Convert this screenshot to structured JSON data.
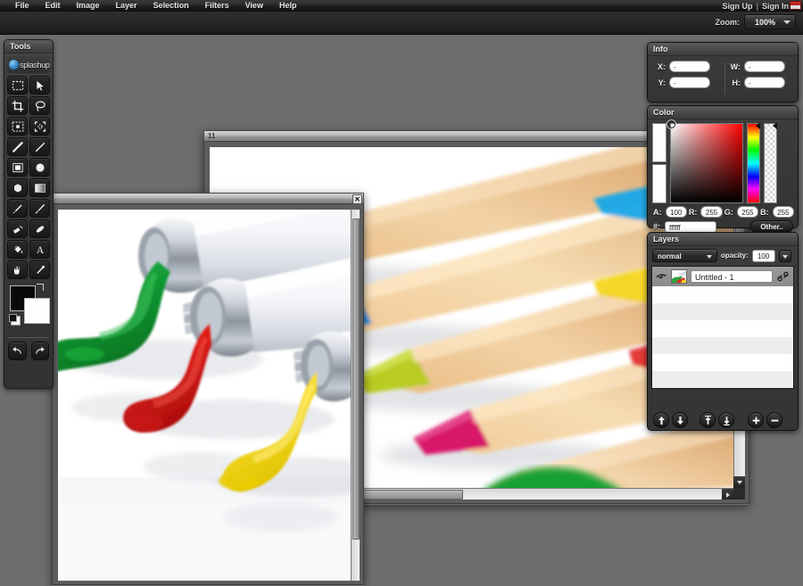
{
  "menu": {
    "items": [
      {
        "label": "File"
      },
      {
        "label": "Edit"
      },
      {
        "label": "Image"
      },
      {
        "label": "Layer"
      },
      {
        "label": "Selection"
      },
      {
        "label": "Filters"
      },
      {
        "label": "View"
      },
      {
        "label": "Help"
      }
    ]
  },
  "auth": {
    "sign_up": "Sign Up",
    "separator": "|",
    "sign_in": "Sign In",
    "flag_icon": "flag-icon"
  },
  "toolbar": {
    "zoom_label": "Zoom:",
    "zoom_value": "100%"
  },
  "tools": {
    "title": "Tools",
    "logo_text": "splashup",
    "items": [
      {
        "name": "marquee-rectangle-tool",
        "icon": "marquee-rectangle-icon"
      },
      {
        "name": "move-tool",
        "icon": "cursor-arrow-icon"
      },
      {
        "name": "crop-tool",
        "icon": "crop-icon"
      },
      {
        "name": "lasso-tool",
        "icon": "lasso-icon"
      },
      {
        "name": "select-all-tool",
        "icon": "select-all-icon"
      },
      {
        "name": "magic-wand-select-tool",
        "icon": "dashed-square-icon"
      },
      {
        "name": "line-tool",
        "icon": "line-icon"
      },
      {
        "name": "pencil-tool",
        "icon": "pencil-stroke-icon"
      },
      {
        "name": "rectangle-shape-tool",
        "icon": "filled-square-icon"
      },
      {
        "name": "ellipse-shape-tool",
        "icon": "filled-circle-icon"
      },
      {
        "name": "polygon-shape-tool",
        "icon": "polygon-icon"
      },
      {
        "name": "gradient-tool",
        "icon": "gradient-icon"
      },
      {
        "name": "brush-tool",
        "icon": "brush-icon"
      },
      {
        "name": "paintbrush-tool",
        "icon": "paintbrush-icon"
      },
      {
        "name": "eraser-tool",
        "icon": "eraser-icon"
      },
      {
        "name": "smudge-tool",
        "icon": "smudge-icon"
      },
      {
        "name": "paint-bucket-tool",
        "icon": "paint-bucket-icon"
      },
      {
        "name": "text-tool",
        "icon": "text-a-icon"
      },
      {
        "name": "hand-tool",
        "icon": "hand-icon"
      },
      {
        "name": "eyedropper-tool",
        "icon": "eyedropper-icon"
      }
    ],
    "foreground_color": "#0a0a0a",
    "background_color": "#fdfdfd",
    "undo_icon": "undo-arrow-icon",
    "redo_icon": "redo-arrow-icon"
  },
  "info": {
    "title": "Info",
    "fields": [
      {
        "label": "X:",
        "value": "-"
      },
      {
        "label": "W:",
        "value": "-"
      },
      {
        "label": "Y:",
        "value": "-"
      },
      {
        "label": "H:",
        "value": "-"
      }
    ]
  },
  "color": {
    "title": "Color",
    "alpha_label": "A:",
    "alpha_value": "100",
    "red_label": "R:",
    "red_value": "255",
    "green_label": "G:",
    "green_value": "255",
    "blue_label": "B:",
    "blue_value": "255",
    "hex_label": "#:",
    "hex_value": "ffffff",
    "other_button": "Other..",
    "current_color": "#ffffff"
  },
  "layers": {
    "title": "Layers",
    "blend_mode": "normal",
    "opacity_label": "opacity:",
    "opacity_value": "100",
    "rows": [
      {
        "name": "Untitled - 1",
        "visible": true,
        "linked": true
      }
    ],
    "buttons": [
      {
        "name": "move-layer-up-button",
        "icon": "arrow-up-icon"
      },
      {
        "name": "move-layer-down-button",
        "icon": "arrow-down-icon"
      },
      {
        "name": "move-layer-top-button",
        "icon": "arrow-to-top-icon"
      },
      {
        "name": "move-layer-bottom-button",
        "icon": "arrow-to-bottom-icon"
      },
      {
        "name": "add-layer-button",
        "icon": "plus-icon"
      },
      {
        "name": "delete-layer-button",
        "icon": "minus-icon"
      }
    ]
  },
  "windows": [
    {
      "name": "pencils-window",
      "title": "11",
      "image_subject": "colored-pencils",
      "close_label": ""
    },
    {
      "name": "paint-tubes-window",
      "title": "",
      "image_subject": "paint-tubes",
      "close_label": "✕"
    }
  ]
}
